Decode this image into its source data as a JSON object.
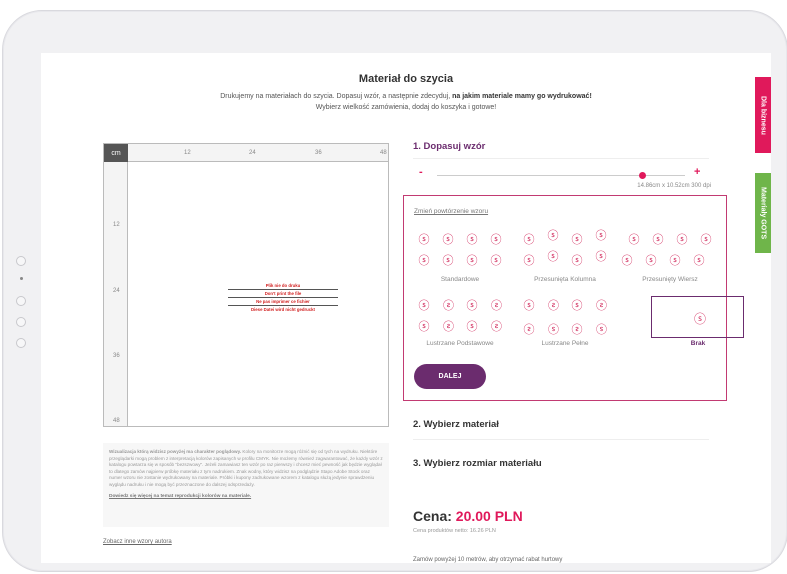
{
  "header": {
    "title": "Materiał do szycia",
    "subtitle_start": "Drukujemy na materiałach do szycia. Dopasuj wzór, a następnie zdecyduj,",
    "subtitle_bold": "na jakim materiale mamy go wydrukować!",
    "subtitle_line2": "Wybierz wielkość zamówienia, dodaj do koszyka i gotowe!"
  },
  "side_tabs": {
    "business": "Dla biznesu",
    "gots": "Materiały GOTS"
  },
  "preview": {
    "unit": "cm",
    "top_ticks": [
      "12",
      "24",
      "36",
      "48"
    ],
    "left_ticks": [
      "12",
      "24",
      "36",
      "48"
    ],
    "warnings": [
      "Plik nie do druku",
      "Don't print the file",
      "Ne pas imprimer ce fichier",
      "Diese Datei wird nicht gedruckt"
    ]
  },
  "disclaimer": {
    "bold_intro": "Wizualizacja którą widzisz powyżej ma charakter poglądowy.",
    "text": "Kolory na monitorze mogą różnić się od tych na wydruku. Niektóre przeglądarki mogą problem z interpretacją kolorów zapisanych w profilu CMYK. Nie możemy również zagwarantować, że każdy wzór z katalogu powtarza się w sposób \"bezszwowy\". Jeżeli zamawiasz ten wzór po raz pierwszy i chcesz mieć pewność jak będzie wyglądał to dlatego zamów najpierw próbkę materiału z tym nadrukiem. Znak wodny, który widzisz na podglądzie Stapo Adobe Stock oraz numer wzoru nie zostanie wydrukowany na materiale. Próbki i kupony zadrukowane wzorem z katalogu służą jedynie sprawdzeniu wyglądu nadruku i nie mogą być przeznaczone do dalszej odsprzedaży.",
    "link": "Dowiedz się więcej na temat reprodukcji kolorów na materiale."
  },
  "author_link": "Zobacz inne wzory autora",
  "step1": {
    "title": "1. Dopasuj wzór",
    "minus": "-",
    "plus": "+",
    "slider_fraction": 0.83,
    "size_readout": "14.86cm x 10.52cm 300 dpi",
    "repeat_link": "Zmień powtórzenie wzoru",
    "options": [
      {
        "label": "Standardowe"
      },
      {
        "label": "Przesunięta Kolumna"
      },
      {
        "label": "Przesunięty Wiersz"
      },
      {
        "label": "Lustrzane Podstawowe"
      },
      {
        "label": "Lustrzane Pełne"
      },
      {
        "label": "Brak",
        "selected": true
      }
    ],
    "button": "DALEJ"
  },
  "step2": {
    "title": "2. Wybierz materiał"
  },
  "step3": {
    "title": "3. Wybierz rozmiar materiału"
  },
  "price": {
    "label": "Cena:",
    "value": "20.00 PLN",
    "netto": "Cena produktów netto: 16.26 PLN",
    "bulk_note": "Zamów powyżej 10 metrów, aby otrzymać rabat hurtowy"
  },
  "colors": {
    "accent": "#e0195b",
    "brand_purple": "#6b2c6e",
    "gots_green": "#6fb54a"
  },
  "icons": {
    "pattern_motif": "strawberry-icon"
  }
}
